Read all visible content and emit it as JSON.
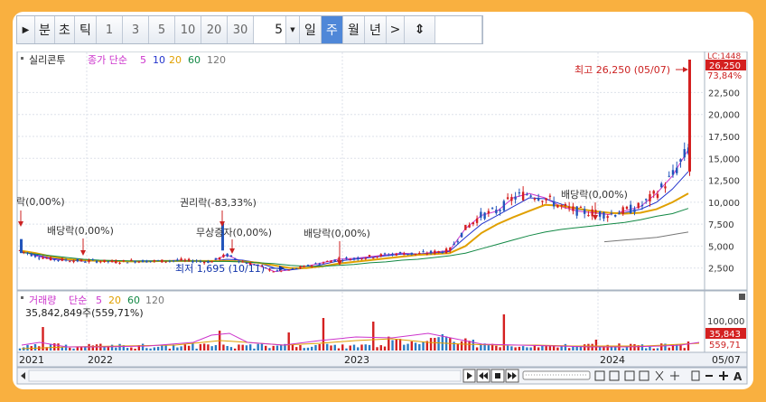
{
  "toolbar": {
    "play_label": "▶",
    "minute_label": "분",
    "second_label": "초",
    "tick_label": "틱",
    "interval_options": [
      "1",
      "3",
      "5",
      "10",
      "20",
      "30"
    ],
    "period_value": "5",
    "day_label": "일",
    "week_label": "주",
    "month_label": "월",
    "year_label": "년",
    "next_label": ">",
    "split_label": "⇕"
  },
  "price_panel": {
    "stock_name": "실리콘투",
    "ma_legend_prefix": "종가 단순",
    "ma_periods": [
      "5",
      "10",
      "20",
      "60",
      "120"
    ],
    "ma_colors": [
      "#cc33cc",
      "#2233cc",
      "#e0a000",
      "#118844",
      "#777777"
    ],
    "y_ticks": [
      "2,500",
      "5,000",
      "7,500",
      "10,000",
      "12,500",
      "15,000",
      "17,500",
      "20,000",
      "22,500"
    ],
    "lc_label": "LC:1448",
    "current_price_label": "26,250",
    "change_pct_label": "73,84%",
    "high_annotation": "최고 26,250 (05/07)",
    "low_annotation": "최저 1,695 (10/11)",
    "events": [
      {
        "label": "락(0,00%)"
      },
      {
        "label": "배당락(0,00%)"
      },
      {
        "label": "권리락(-83,33%)"
      },
      {
        "label": "무상증자(0,00%)"
      },
      {
        "label": "배당락(0,00%)"
      },
      {
        "label": "배당락(0,00%)"
      }
    ]
  },
  "volume_panel": {
    "title": "거래량",
    "ma_legend_prefix": "단순",
    "ma_periods": [
      "5",
      "20",
      "60",
      "120"
    ],
    "volume_text": "35,842,849주(559,71%)",
    "y_tick": "100,000",
    "current_volume_label": "35,843",
    "pct_label": "559,71"
  },
  "x_axis": {
    "labels": [
      "2021",
      "2022",
      "2023",
      "2024",
      "05/07"
    ]
  },
  "colors": {
    "up": "#d42020",
    "down": "#2255bb",
    "volume_up": "#d42020",
    "volume_down": "#2a7cc4",
    "background_border": "#f9b040"
  },
  "chart_data": {
    "type": "candlestick",
    "y_range": [
      0,
      26250
    ],
    "y_ticks": [
      2500,
      5000,
      7500,
      10000,
      12500,
      15000,
      17500,
      20000,
      22500
    ],
    "high": 26250,
    "high_date": "05/07",
    "low": 1695,
    "low_date": "10/11",
    "last_price": 26250,
    "series": [
      {
        "name": "5",
        "values": [
          4500,
          3900,
          3500,
          3400,
          3300,
          3300,
          3200,
          3300,
          3300,
          3300,
          3400,
          3300,
          3200,
          4000,
          3200,
          2800,
          2100,
          2300,
          2700,
          3100,
          3500,
          3600,
          3800,
          4000,
          4200,
          4100,
          4300,
          4500,
          7000,
          8500,
          9000,
          10500,
          11000,
          10500,
          9500,
          9000,
          8800,
          8600,
          9000,
          9500,
          11000,
          13000,
          16000
        ]
      },
      {
        "name": "10",
        "values": [
          4600,
          4000,
          3600,
          3400,
          3300,
          3300,
          3250,
          3250,
          3300,
          3300,
          3350,
          3300,
          3250,
          3500,
          3400,
          3100,
          2500,
          2300,
          2500,
          2900,
          3300,
          3500,
          3700,
          3900,
          4100,
          4100,
          4200,
          4400,
          6000,
          7500,
          8500,
          9500,
          10500,
          10400,
          9800,
          9200,
          9000,
          8800,
          8800,
          9200,
          10000,
          11500,
          13500
        ]
      },
      {
        "name": "20",
        "values": [
          4500,
          4200,
          3800,
          3500,
          3400,
          3300,
          3300,
          3250,
          3250,
          3300,
          3300,
          3300,
          3300,
          3300,
          3250,
          3100,
          2800,
          2500,
          2500,
          2700,
          3000,
          3200,
          3400,
          3600,
          3800,
          4000,
          4100,
          4200,
          5000,
          6500,
          7500,
          8300,
          9000,
          9700,
          9600,
          9300,
          9000,
          8800,
          8700,
          8800,
          9200,
          10000,
          11000
        ]
      },
      {
        "name": "60",
        "values": [
          4300,
          4100,
          3900,
          3700,
          3500,
          3400,
          3350,
          3300,
          3300,
          3300,
          3300,
          3300,
          3250,
          3250,
          3200,
          3100,
          3000,
          2800,
          2700,
          2700,
          2800,
          2900,
          3100,
          3200,
          3400,
          3500,
          3700,
          3900,
          4200,
          4700,
          5200,
          5700,
          6200,
          6600,
          6900,
          7100,
          7300,
          7500,
          7700,
          8000,
          8400,
          8700,
          9300
        ]
      },
      {
        "name": "120",
        "values": [
          5500,
          5600,
          5700,
          5800,
          5900,
          6000,
          6200,
          6400,
          6600
        ]
      }
    ]
  }
}
